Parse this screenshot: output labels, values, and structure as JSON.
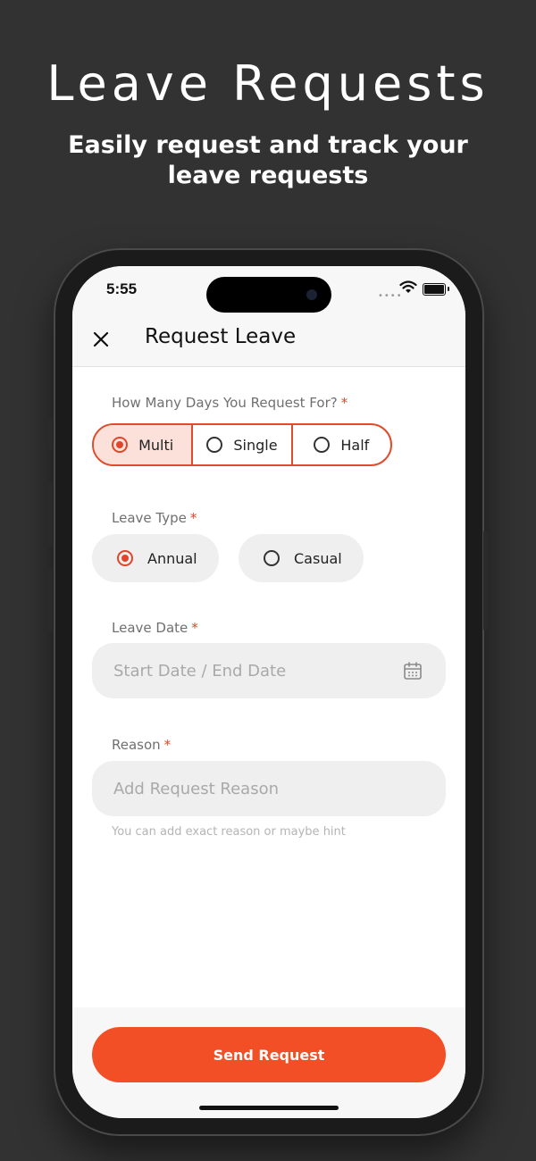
{
  "hero": {
    "title": "Leave Requests",
    "subtitle": "Easily request and track your leave requests"
  },
  "status_bar": {
    "time": "5:55"
  },
  "header": {
    "title": "Request Leave",
    "close_icon": "close-icon"
  },
  "days": {
    "label": "How Many Days You Request For?",
    "required_mark": "*",
    "options": [
      "Multi",
      "Single",
      "Half"
    ],
    "selected": "Multi"
  },
  "leave_type": {
    "label": "Leave Type",
    "required_mark": "*",
    "options": [
      "Annual",
      "Casual"
    ],
    "selected": "Annual"
  },
  "leave_date": {
    "label": "Leave Date",
    "required_mark": "*",
    "placeholder": "Start Date / End Date",
    "icon": "calendar-icon"
  },
  "reason": {
    "label": "Reason",
    "required_mark": "*",
    "placeholder": "Add Request Reason",
    "hint": "You can add exact reason or maybe hint"
  },
  "actions": {
    "send_label": "Send Request"
  },
  "colors": {
    "accent": "#F24F26",
    "background": "#323233",
    "selected_segment": "#FBE1DA",
    "field_bg": "#EFEFEF"
  }
}
